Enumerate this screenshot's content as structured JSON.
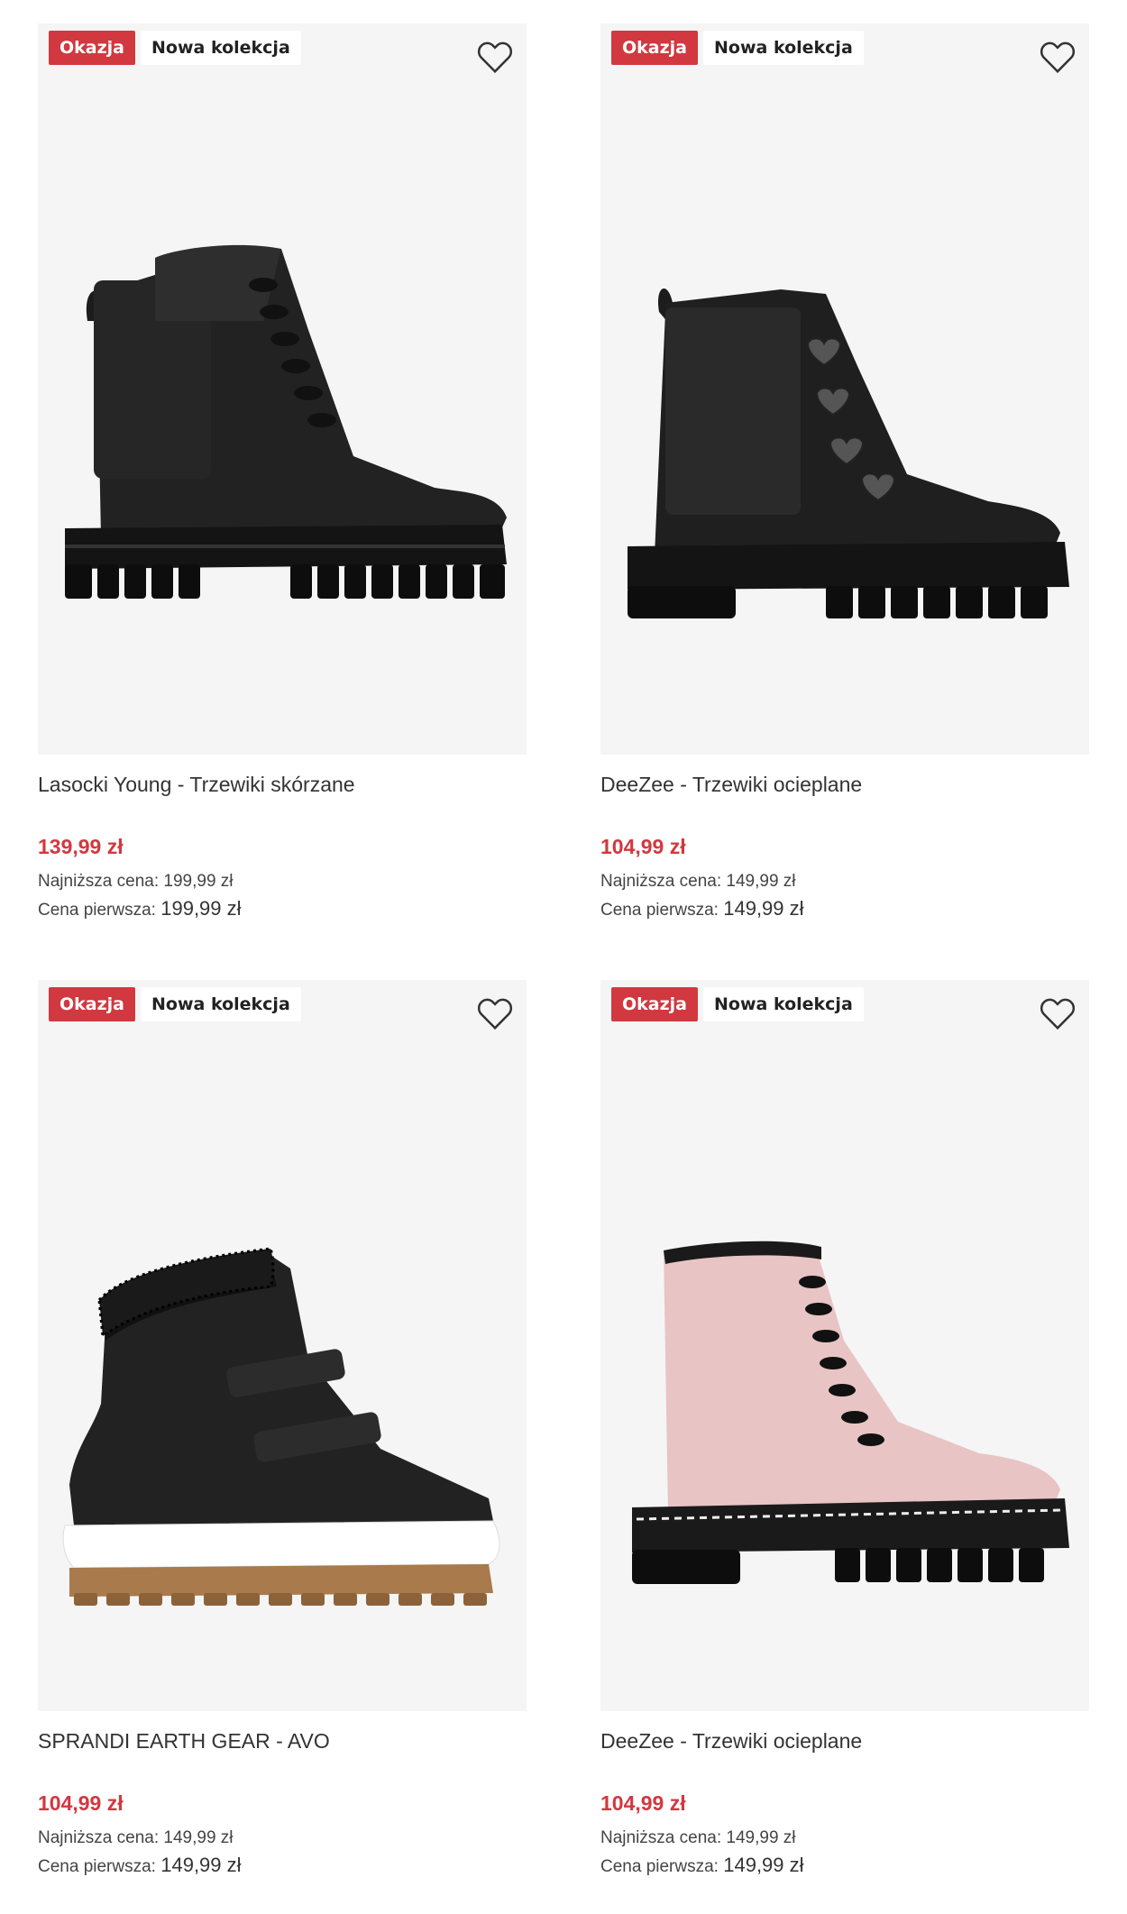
{
  "colors": {
    "sale_badge": "#d2383f",
    "price": "#d2383f",
    "image_bg": "#f5f5f5"
  },
  "products": [
    {
      "badges": [
        "Okazja",
        "Nowa kolekcja"
      ],
      "name": "Lasocki Young - Trzewiki skórzane",
      "price": "139,99 zł",
      "lowest_label": "Najniższa cena:",
      "lowest_value": "199,99 zł",
      "first_label": "Cena pierwsza:",
      "first_value": "199,99 zł",
      "image": "black-leather-boot",
      "wishlist_icon": "heart-outline-icon"
    },
    {
      "badges": [
        "Okazja",
        "Nowa kolekcja"
      ],
      "name": "DeeZee - Trzewiki ocieplane",
      "price": "104,99 zł",
      "lowest_label": "Najniższa cena:",
      "lowest_value": "149,99 zł",
      "first_label": "Cena pierwsza:",
      "first_value": "149,99 zł",
      "image": "black-boot-hearts",
      "wishlist_icon": "heart-outline-icon"
    },
    {
      "badges": [
        "Okazja",
        "Nowa kolekcja"
      ],
      "name": "SPRANDI EARTH GEAR - AVO",
      "price": "104,99 zł",
      "lowest_label": "Najniższa cena:",
      "lowest_value": "149,99 zł",
      "first_label": "Cena pierwsza:",
      "first_value": "149,99 zł",
      "image": "black-velcro-winter-boot",
      "wishlist_icon": "heart-outline-icon"
    },
    {
      "badges": [
        "Okazja",
        "Nowa kolekcja"
      ],
      "name": "DeeZee - Trzewiki ocieplane",
      "price": "104,99 zł",
      "lowest_label": "Najniższa cena:",
      "lowest_value": "149,99 zł",
      "first_label": "Cena pierwsza:",
      "first_value": "149,99 zł",
      "image": "pink-lace-up-boot",
      "wishlist_icon": "heart-outline-icon"
    }
  ]
}
